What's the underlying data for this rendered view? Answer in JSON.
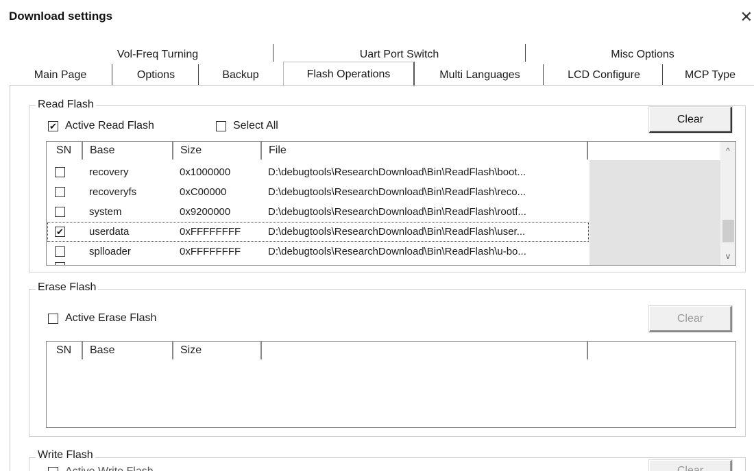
{
  "window": {
    "title": "Download settings",
    "close_glyph": "✕"
  },
  "tabs": {
    "row1": [
      "Vol-Freq Turning",
      "Uart Port Switch",
      "Misc Options"
    ],
    "row2": [
      "Main Page",
      "Options",
      "Backup",
      "Flash Operations",
      "Multi Languages",
      "LCD Configure",
      "MCP Type"
    ],
    "active": "Flash Operations"
  },
  "read_flash": {
    "group_title": "Read Flash",
    "active_label": "Active Read Flash",
    "active_checked": true,
    "select_all_label": "Select All",
    "select_all_checked": false,
    "clear_label": "Clear",
    "columns": [
      "SN",
      "Base",
      "Size",
      "File",
      ""
    ],
    "rows": [
      {
        "checked": false,
        "base": "recovery",
        "size": "0x1000000",
        "file": "D:\\debugtools\\ResearchDownload\\Bin\\ReadFlash\\boot..."
      },
      {
        "checked": false,
        "base": "recoveryfs",
        "size": "0xC00000",
        "file": "D:\\debugtools\\ResearchDownload\\Bin\\ReadFlash\\reco..."
      },
      {
        "checked": false,
        "base": "system",
        "size": "0x9200000",
        "file": "D:\\debugtools\\ResearchDownload\\Bin\\ReadFlash\\rootf..."
      },
      {
        "checked": true,
        "base": "userdata",
        "size": "0xFFFFFFFF",
        "file": "D:\\debugtools\\ResearchDownload\\Bin\\ReadFlash\\user..."
      },
      {
        "checked": false,
        "base": "splloader",
        "size": "0xFFFFFFFF",
        "file": "D:\\debugtools\\ResearchDownload\\Bin\\ReadFlash\\u-bo..."
      }
    ],
    "scroll_up_glyph": "^",
    "scroll_down_glyph": "v"
  },
  "erase_flash": {
    "group_title": "Erase Flash",
    "active_label": "Active Erase Flash",
    "active_checked": false,
    "clear_label": "Clear",
    "columns": [
      "SN",
      "Base",
      "Size",
      "",
      ""
    ]
  },
  "write_flash": {
    "group_title": "Write Flash",
    "active_label": "Active Write Flash",
    "clear_label": "Clear"
  },
  "icons": {
    "check": "✔",
    "close": "close-icon"
  }
}
